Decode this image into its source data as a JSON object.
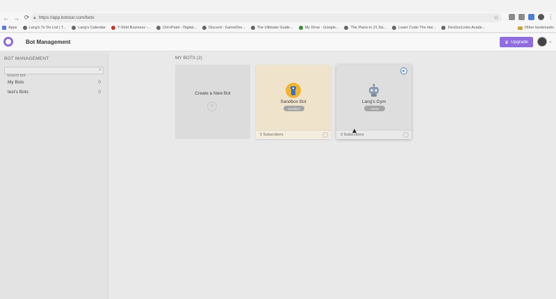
{
  "browser": {
    "url": "https://app.botstar.com/bots",
    "bookmarks": [
      {
        "label": "Apps",
        "color": "#5b7bd5"
      },
      {
        "label": "Lang's To Do List | T...",
        "color": "#555555"
      },
      {
        "label": "Lang's Calendar",
        "color": "#555555"
      },
      {
        "label": "T-Shirt Business -...",
        "color": "#c0392b"
      },
      {
        "label": "Ctrl+Paint - Digital...",
        "color": "#555555"
      },
      {
        "label": "Discord - GameDev...",
        "color": "#555555"
      },
      {
        "label": "The Ultimate Guide...",
        "color": "#555555"
      },
      {
        "label": "My Drive - Google...",
        "color": "#3b8e3b"
      },
      {
        "label": "The Piano in 21 Da...",
        "color": "#555555"
      },
      {
        "label": "Learn Code The Har...",
        "color": "#555555"
      },
      {
        "label": "DevDocLinks Acade...",
        "color": "#555555"
      }
    ],
    "other_bookmarks": "Other bookmarks"
  },
  "header": {
    "title": "Bot Management",
    "upgrade_label": "Upgrade",
    "accent": "#8f6cdf"
  },
  "sidebar": {
    "heading": "BOT MANAGEMENT",
    "search_placeholder": "Search bot",
    "items": [
      {
        "label": "My Bots",
        "count": "0"
      },
      {
        "label": "test's Bots",
        "count": "0"
      }
    ]
  },
  "main": {
    "heading": "MY BOTS (2)",
    "create_label": "Create a New Bot",
    "bots": [
      {
        "name": "Sandbox Bot",
        "badge": "Sandbox",
        "subscribers": "0 Subscribers",
        "bg": "#efe3cc"
      },
      {
        "name": "Lang's Gym",
        "badge": "Admin",
        "subscribers": "0 Subscribers",
        "bg": "#dedede"
      }
    ]
  }
}
